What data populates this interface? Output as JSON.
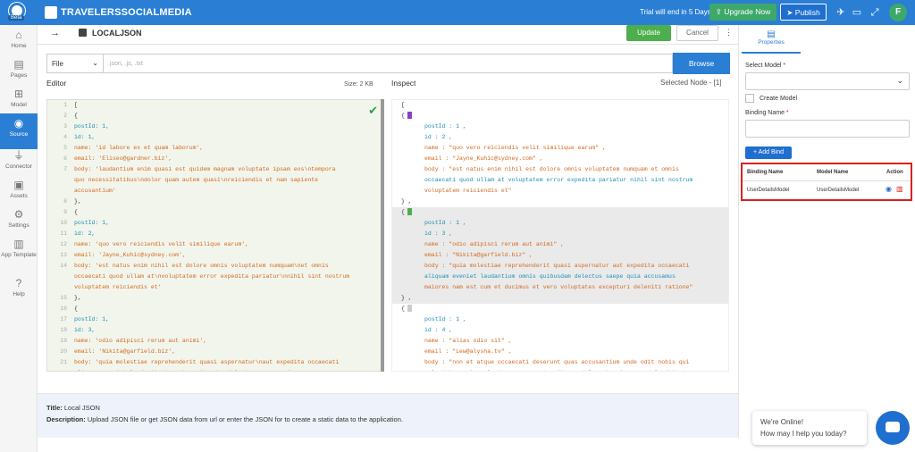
{
  "topbar": {
    "badge": "Beta",
    "app_title": "TRAVELERSSOCIALMEDIA",
    "trial": "Trial will end in 5 Days",
    "upgrade": "Upgrade Now",
    "publish": "Publish",
    "avatar": "F"
  },
  "sidebar": [
    {
      "label": "Home",
      "icon": "home-icon"
    },
    {
      "label": "Pages",
      "icon": "pages-icon"
    },
    {
      "label": "Model",
      "icon": "model-icon"
    },
    {
      "label": "Source",
      "icon": "database-icon"
    },
    {
      "label": "Connector",
      "icon": "plug-icon"
    },
    {
      "label": "Assets",
      "icon": "assets-icon"
    },
    {
      "label": "Settings",
      "icon": "gear-icon"
    },
    {
      "label": "App Template",
      "icon": "template-icon"
    },
    {
      "label": "Help",
      "icon": "help-icon"
    }
  ],
  "header": {
    "title": "LOCALJSON",
    "update": "Update",
    "cancel": "Cancel"
  },
  "source": {
    "select": "File",
    "placeholder": ".json, .js, .txt",
    "browse": "Browse"
  },
  "editor": {
    "label": "Editor",
    "size": "Size: 2 KB",
    "line_numbers": [
      "1",
      "2",
      "3",
      "4",
      "5",
      "6",
      "7",
      "8",
      "9",
      "10",
      "11",
      "12",
      "13",
      "14",
      "15",
      "16",
      "17",
      "18",
      "19",
      "20",
      "21",
      "22",
      "23",
      "24",
      "25"
    ],
    "lines": [
      "[",
      "  {",
      "    postId: 1,",
      "    id: 1,",
      "    name: 'id labore ex et quam laborum',",
      "    email: 'Eliseo@gardner.biz',",
      "    body: 'laudantium enim quasi est quidem magnam voluptate ipsam eos\\ntempora",
      "quo necessitatibus\\ndolor quam autem quasi\\nreiciendis et nam sapiente",
      "accusantium'",
      "  },",
      "  {",
      "    postId: 1,",
      "    id: 2,",
      "    name: 'quo vero reiciendis velit similique earum',",
      "    email: 'Jayne_Kuhic@sydney.com',",
      "    body: 'est natus enim nihil est dolore omnis voluptatem numquam\\net omnis",
      "occaecati quod ullam at\\nvoluptatem error expedita pariatur\\nnihil sint nostrum",
      "voluptatem reiciendis et'",
      "  },",
      "  {",
      "    postId: 1,",
      "    id: 3,",
      "    name: 'odio adipisci rerum aut animi',",
      "    email: 'Nikita@garfield.biz',",
      "    body: 'quia molestiae reprehenderit quasi aspernatur\\naut expedita occaecati",
      "aliquam eveniet laudantium\\nomnis quibusdam delectus saepe quia accusamus"
    ]
  },
  "inspect": {
    "label": "Inspect",
    "selected": "Selected Node - [1]",
    "open_bracket": "[",
    "close_brace": "} ,",
    "nodes": [
      {
        "lines": [
          "postId : 1 ,",
          "id : 2 ,",
          "name : \"quo vero reiciendis velit similique earum\" ,",
          "email : \"Jayne_Kuhic@sydney.com\" ,",
          "body : \"est natus enim nihil est dolore omnis voluptatem numquam et omnis",
          "occaecati quod ullam at voluptatem error expedita pariatur nihil sint nostrum",
          "voluptatem reiciendis et\""
        ],
        "marker": "#8a3fc7"
      },
      {
        "lines": [
          "postId : 1 ,",
          "id : 3 ,",
          "name : \"odio adipisci rerum aut animi\" ,",
          "email : \"Nikita@garfield.biz\" ,",
          "body : \"quia molestiae reprehenderit quasi aspernatur aut expedita occaecati",
          "aliquam eveniet laudantium omnis quibusdam delectus saepe quia accusamus",
          "maiores nam est cum et ducimus et vero voluptates excepturi deleniti ratione\""
        ],
        "marker": "#4cae4c"
      },
      {
        "lines": [
          "postId : 1 ,",
          "id : 4 ,",
          "name : \"alias odio sit\" ,",
          "email : \"Lew@alysha.tv\" ,",
          "body : \"non et atque occaecati deserunt quas accusantium unde odit nobis qui",
          "voluptatem quia voluptas consequuntur itaque dolor et qui rerum deleniti ut"
        ],
        "marker": "#ccc"
      }
    ]
  },
  "footer": {
    "title_label": "Title:",
    "title": "Local JSON",
    "desc_label": "Description:",
    "desc": "Upload JSON file or get JSON data from url or enter the JSON for to create a static data to the application."
  },
  "properties": {
    "tab": "Properties",
    "select_model": "Select Model",
    "create_model": "Create Model",
    "binding_name": "Binding Name",
    "required": "*",
    "add_bind": "+ Add Bind",
    "columns": [
      "Binding Name",
      "Model Name",
      "Action"
    ],
    "row": {
      "binding": "UserDetailsModel",
      "model": "UserDetailsModel"
    }
  },
  "chat": {
    "line1": "We're Online!",
    "line2": "How may I help you today?"
  }
}
